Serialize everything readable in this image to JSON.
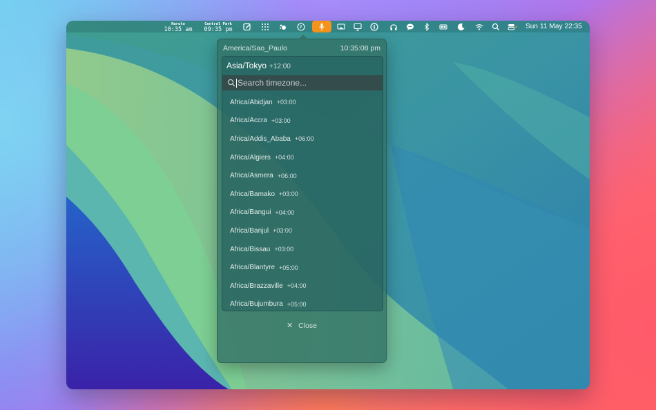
{
  "menubar": {
    "clock1": {
      "label": "Naruto",
      "time": "10:35 am"
    },
    "clock2": {
      "label": "Central Park",
      "time": "09:35 pm"
    },
    "datetime": "Sun 11 May  22:35",
    "icons": [
      "compose-icon",
      "grid-dots-icon",
      "fan-icon",
      "clock-icon",
      "microphone-icon",
      "cast-icon",
      "display-icon",
      "onepassword-icon",
      "headphones-icon",
      "chat-icon",
      "bluetooth-icon",
      "battery-icon",
      "moon-icon",
      "wifi-icon",
      "search-icon",
      "control-center-icon"
    ],
    "accent": "#f5941d"
  },
  "popup": {
    "current_zone": "America/Sao_Paulo",
    "current_time": "10:35:08 pm",
    "selected_zone": "Asia/Tokyo",
    "selected_offset": "+12:00",
    "search_placeholder": "Search timezone...",
    "timezones": [
      {
        "name": "Africa/Abidjan",
        "offset": "+03:00"
      },
      {
        "name": "Africa/Accra",
        "offset": "+03:00"
      },
      {
        "name": "Africa/Addis_Ababa",
        "offset": "+06:00"
      },
      {
        "name": "Africa/Algiers",
        "offset": "+04:00"
      },
      {
        "name": "Africa/Asmera",
        "offset": "+06:00"
      },
      {
        "name": "Africa/Bamako",
        "offset": "+03:00"
      },
      {
        "name": "Africa/Bangui",
        "offset": "+04:00"
      },
      {
        "name": "Africa/Banjul",
        "offset": "+03:00"
      },
      {
        "name": "Africa/Bissau",
        "offset": "+03:00"
      },
      {
        "name": "Africa/Blantyre",
        "offset": "+05:00"
      },
      {
        "name": "Africa/Brazzaville",
        "offset": "+04:00"
      },
      {
        "name": "Africa/Bujumbura",
        "offset": "+05:00"
      }
    ],
    "close_label": "Close"
  }
}
